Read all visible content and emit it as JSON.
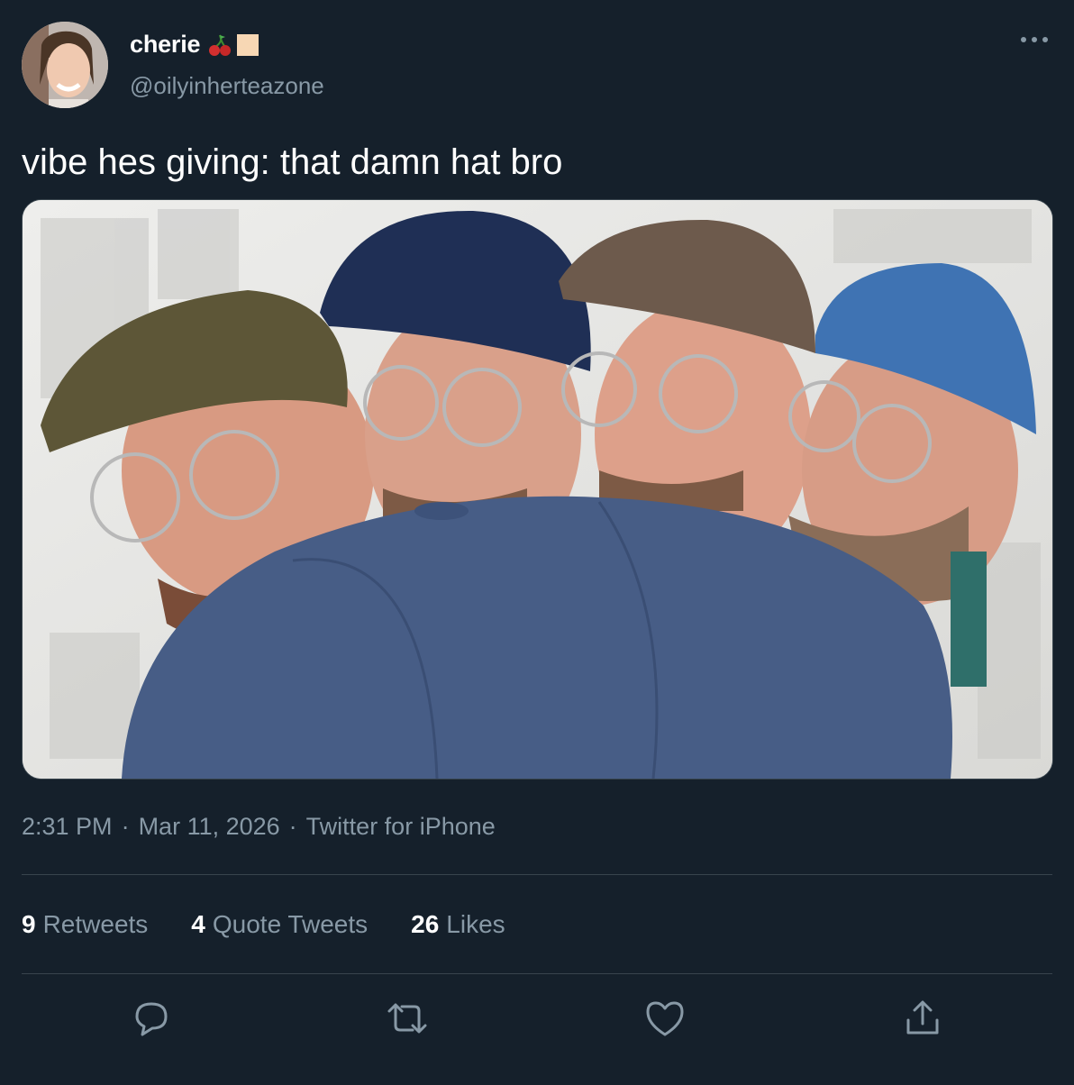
{
  "author": {
    "display_name": "cherie",
    "handle": "@oilyinherteazone",
    "emoji": [
      "cherries-emoji",
      "peach-square-emoji"
    ]
  },
  "tweet": {
    "text": "vibe hes giving: that damn hat bro"
  },
  "meta": {
    "time": "2:31 PM",
    "separator": "·",
    "date": "Mar 11, 2026",
    "source": "Twitter for iPhone"
  },
  "stats": {
    "retweets_count": "9",
    "retweets_label": "Retweets",
    "quotes_count": "4",
    "quotes_label": "Quote Tweets",
    "likes_count": "26",
    "likes_label": "Likes"
  },
  "colors": {
    "background": "#15202b",
    "secondary_text": "#8899a6",
    "divider": "#38444d"
  },
  "icons": [
    "more-icon",
    "reply-icon",
    "retweet-icon",
    "like-icon",
    "share-icon"
  ]
}
